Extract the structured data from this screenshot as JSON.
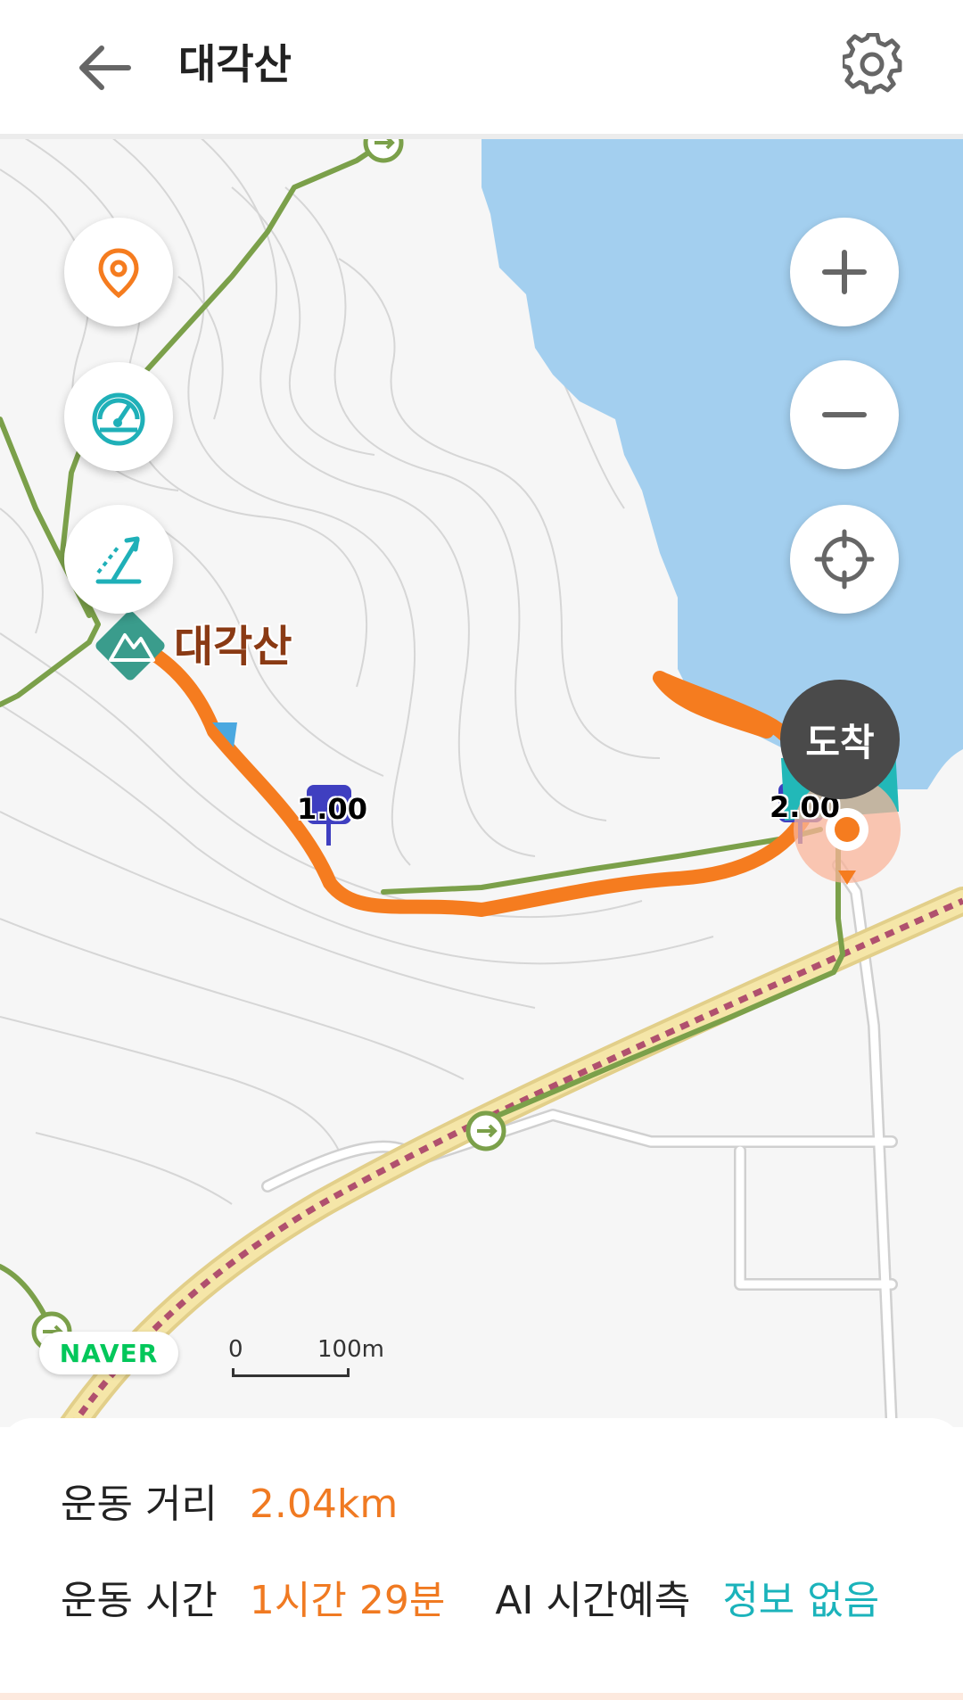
{
  "header": {
    "title": "대각산",
    "back_icon": "arrow-left-icon",
    "settings_icon": "gear-icon"
  },
  "map": {
    "peak_label": "대각산",
    "km_markers": [
      "1.00",
      "2.00"
    ],
    "arrive_label": "도착",
    "provider": "NAVER",
    "scale_start": "0",
    "scale_distance": "100m",
    "colors": {
      "track": "#f57c1f",
      "trail": "#7ba04a",
      "water": "#a3cfef",
      "road": "#f5e6a8",
      "rail": "#b0506e"
    },
    "controls": {
      "left": [
        "location-pin-icon",
        "speedometer-icon",
        "slope-icon"
      ],
      "right": [
        "zoom-in-icon",
        "zoom-out-icon",
        "crosshair-icon"
      ]
    }
  },
  "stats": {
    "distance_label": "운동 거리",
    "distance_value": "2.04km",
    "time_label": "운동 시간",
    "time_value": "1시간 29분",
    "ai_label": "AI 시간예측",
    "ai_value": "정보 없음"
  }
}
